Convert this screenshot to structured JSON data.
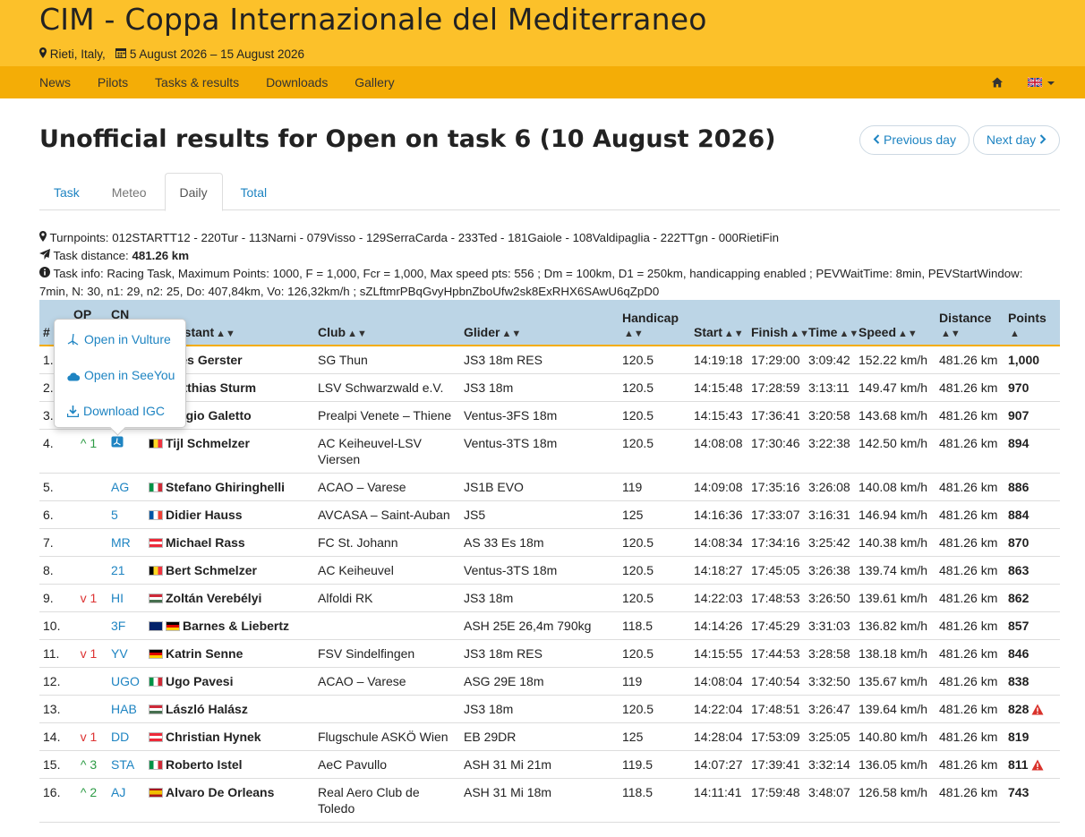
{
  "header": {
    "title": "CIM - Coppa Internazionale del Mediterraneo",
    "location": "Rieti, Italy,",
    "dates": "5 August 2026 – 15 August 2026"
  },
  "nav": {
    "items": [
      "News",
      "Pilots",
      "Tasks & results",
      "Downloads",
      "Gallery"
    ]
  },
  "page": {
    "title": "Unofficial results for Open on task 6 (10 August 2026)",
    "prev_day": "Previous day",
    "next_day": "Next day"
  },
  "tabs": [
    "Task",
    "Meteo",
    "Daily",
    "Total"
  ],
  "info": {
    "turnpoints_label": "Turnpoints:",
    "turnpoints": "012STARTT12 - 220Tur - 113Narni - 079Visso - 129SerraCarda - 233Ted - 181Gaiole - 108Valdipaglia - 222TTgn - 000RietiFin",
    "distance_label": "Task distance:",
    "distance": "481.26 km",
    "task_info_label": "Task info:",
    "task_info_1": "Racing Task, Maximum Points: 1000, F = 1,000, Fcr = 1,000, Max speed pts: 556 ; Dm = 100km, D1 = 250km, handicapping enabled ; PEVWaitTime: 8min, PEVStartWindow:",
    "task_info_2": "7min, N: 30, n1: 29, n2: 25, Do: 407,84km, Vo: 126,32km/h ; sZLftmrPBqGvyHpbnZboUfw2sk8ExRHX6SAwU6qZpD0"
  },
  "table": {
    "headers": {
      "rank": "#",
      "op": "OP",
      "cn": "CN",
      "contestant": "Contestant",
      "club": "Club",
      "glider": "Glider",
      "handicap": "Handicap",
      "start": "Start",
      "finish": "Finish",
      "time": "Time",
      "speed": "Speed",
      "distance": "Distance",
      "points": "Points"
    },
    "rows": [
      {
        "rank": "1.",
        "op": "",
        "cn": "",
        "contestant": "Yves Gerster",
        "club": "SG Thun",
        "glider": "JS3 18m RES",
        "handicap": "120.5",
        "start": "14:19:18",
        "finish": "17:29:00",
        "time": "3:09:42",
        "speed": "152.22 km/h",
        "distance": "481.26 km",
        "points": "1,000",
        "flags": [
          "ch"
        ],
        "warn": false
      },
      {
        "rank": "2.",
        "op": "",
        "cn": "",
        "contestant": "Matthias Sturm",
        "club": "LSV Schwarzwald e.V.",
        "glider": "JS3 18m",
        "handicap": "120.5",
        "start": "14:15:48",
        "finish": "17:28:59",
        "time": "3:13:11",
        "speed": "149.47 km/h",
        "distance": "481.26 km",
        "points": "970",
        "flags": [
          "de"
        ],
        "warn": false
      },
      {
        "rank": "3.",
        "op": "",
        "cn": "",
        "contestant": "Sergio Galetto",
        "club": "Prealpi Venete – Thiene",
        "glider": "Ventus-3FS 18m",
        "handicap": "120.5",
        "start": "14:15:43",
        "finish": "17:36:41",
        "time": "3:20:58",
        "speed": "143.68 km/h",
        "distance": "481.26 km",
        "points": "907",
        "flags": [
          "it"
        ],
        "warn": false
      },
      {
        "rank": "4.",
        "op": "^ 1",
        "opdir": "up",
        "cn": "",
        "contestant": "Tijl Schmelzer",
        "club": "AC Keiheuvel-LSV Viersen",
        "glider": "Ventus-3TS 18m",
        "handicap": "120.5",
        "start": "14:08:08",
        "finish": "17:30:46",
        "time": "3:22:38",
        "speed": "142.50 km/h",
        "distance": "481.26 km",
        "points": "894",
        "flags": [
          "be"
        ],
        "warn": false
      },
      {
        "rank": "5.",
        "op": "",
        "cn": "AG",
        "contestant": "Stefano Ghiringhelli",
        "club": "ACAO – Varese",
        "glider": "JS1B EVO",
        "handicap": "119",
        "start": "14:09:08",
        "finish": "17:35:16",
        "time": "3:26:08",
        "speed": "140.08 km/h",
        "distance": "481.26 km",
        "points": "886",
        "flags": [
          "it"
        ],
        "warn": false
      },
      {
        "rank": "6.",
        "op": "",
        "cn": "5",
        "contestant": "Didier Hauss",
        "club": "AVCASA – Saint-Auban",
        "glider": "JS5",
        "handicap": "125",
        "start": "14:16:36",
        "finish": "17:33:07",
        "time": "3:16:31",
        "speed": "146.94 km/h",
        "distance": "481.26 km",
        "points": "884",
        "flags": [
          "fr"
        ],
        "warn": false
      },
      {
        "rank": "7.",
        "op": "",
        "cn": "MR",
        "contestant": "Michael Rass",
        "club": "FC St. Johann",
        "glider": "AS 33 Es 18m",
        "handicap": "120.5",
        "start": "14:08:34",
        "finish": "17:34:16",
        "time": "3:25:42",
        "speed": "140.38 km/h",
        "distance": "481.26 km",
        "points": "870",
        "flags": [
          "at"
        ],
        "warn": false
      },
      {
        "rank": "8.",
        "op": "",
        "cn": "21",
        "contestant": "Bert Schmelzer",
        "club": "AC Keiheuvel",
        "glider": "Ventus-3TS 18m",
        "handicap": "120.5",
        "start": "14:18:27",
        "finish": "17:45:05",
        "time": "3:26:38",
        "speed": "139.74 km/h",
        "distance": "481.26 km",
        "points": "863",
        "flags": [
          "be"
        ],
        "warn": false
      },
      {
        "rank": "9.",
        "op": "v 1",
        "opdir": "down",
        "cn": "HI",
        "contestant": "Zoltán Verebélyi",
        "club": "Alfoldi RK",
        "glider": "JS3 18m",
        "handicap": "120.5",
        "start": "14:22:03",
        "finish": "17:48:53",
        "time": "3:26:50",
        "speed": "139.61 km/h",
        "distance": "481.26 km",
        "points": "862",
        "flags": [
          "hu"
        ],
        "warn": false
      },
      {
        "rank": "10.",
        "op": "",
        "cn": "3F",
        "contestant": "Barnes & Liebertz",
        "club": "",
        "glider": "ASH 25E 26,4m 790kg",
        "handicap": "118.5",
        "start": "14:14:26",
        "finish": "17:45:29",
        "time": "3:31:03",
        "speed": "136.82 km/h",
        "distance": "481.26 km",
        "points": "857",
        "flags": [
          "au",
          "de"
        ],
        "warn": false
      },
      {
        "rank": "11.",
        "op": "v 1",
        "opdir": "down",
        "cn": "YV",
        "contestant": "Katrin Senne",
        "club": "FSV Sindelfingen",
        "glider": "JS3 18m RES",
        "handicap": "120.5",
        "start": "14:15:55",
        "finish": "17:44:53",
        "time": "3:28:58",
        "speed": "138.18 km/h",
        "distance": "481.26 km",
        "points": "846",
        "flags": [
          "de"
        ],
        "warn": false
      },
      {
        "rank": "12.",
        "op": "",
        "cn": "UGO",
        "contestant": "Ugo Pavesi",
        "club": "ACAO – Varese",
        "glider": "ASG 29E 18m",
        "handicap": "119",
        "start": "14:08:04",
        "finish": "17:40:54",
        "time": "3:32:50",
        "speed": "135.67 km/h",
        "distance": "481.26 km",
        "points": "838",
        "flags": [
          "it"
        ],
        "warn": false
      },
      {
        "rank": "13.",
        "op": "",
        "cn": "HAB",
        "contestant": "László Halász",
        "club": "",
        "glider": "JS3 18m",
        "handicap": "120.5",
        "start": "14:22:04",
        "finish": "17:48:51",
        "time": "3:26:47",
        "speed": "139.64 km/h",
        "distance": "481.26 km",
        "points": "828",
        "flags": [
          "hu"
        ],
        "warn": true
      },
      {
        "rank": "14.",
        "op": "v 1",
        "opdir": "down",
        "cn": "DD",
        "contestant": "Christian Hynek",
        "club": "Flugschule ASKÖ Wien",
        "glider": "EB 29DR",
        "handicap": "125",
        "start": "14:28:04",
        "finish": "17:53:09",
        "time": "3:25:05",
        "speed": "140.80 km/h",
        "distance": "481.26 km",
        "points": "819",
        "flags": [
          "at"
        ],
        "warn": false
      },
      {
        "rank": "15.",
        "op": "^ 3",
        "opdir": "up",
        "cn": "STA",
        "contestant": "Roberto Istel",
        "club": "AeC Pavullo",
        "glider": "ASH 31 Mi 21m",
        "handicap": "119.5",
        "start": "14:07:27",
        "finish": "17:39:41",
        "time": "3:32:14",
        "speed": "136.05 km/h",
        "distance": "481.26 km",
        "points": "811",
        "flags": [
          "it"
        ],
        "warn": true
      },
      {
        "rank": "16.",
        "op": "^ 2",
        "opdir": "up",
        "cn": "AJ",
        "contestant": "Alvaro De Orleans",
        "club": "Real Aero Club de Toledo",
        "glider": "ASH 31 Mi 18m",
        "handicap": "118.5",
        "start": "14:11:41",
        "finish": "17:59:48",
        "time": "3:48:07",
        "speed": "126.58 km/h",
        "distance": "481.26 km",
        "points": "743",
        "flags": [
          "es"
        ],
        "warn": false
      }
    ]
  },
  "popover": {
    "vulture": "Open in Vulture",
    "seeyou": "Open in SeeYou",
    "igc": "Download IGC"
  },
  "colors": {
    "banner": "#fcc12a",
    "navbar": "#f4ad06",
    "link": "#1e84c2",
    "table_header": "#bcd5e6",
    "up": "#2d9b45",
    "down": "#d33"
  }
}
